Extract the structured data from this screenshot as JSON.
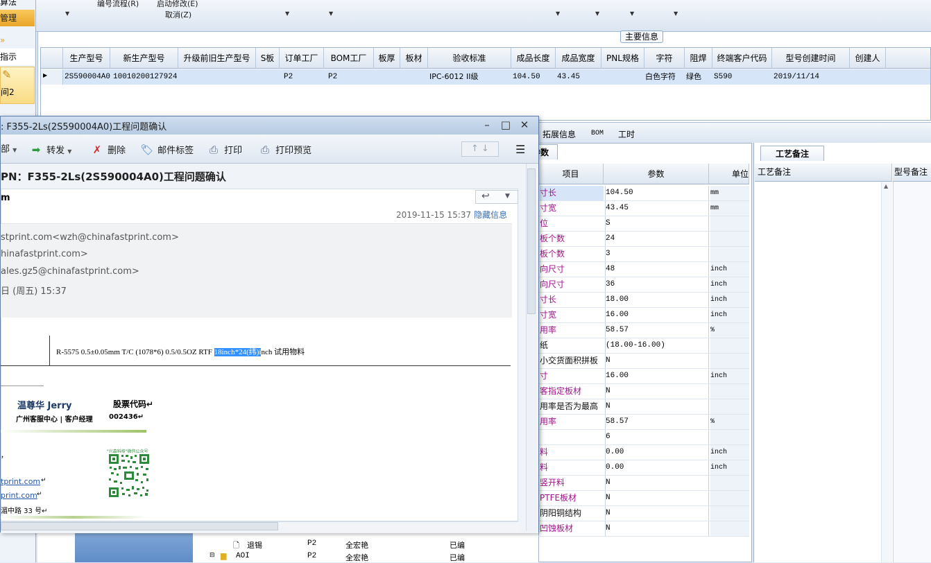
{
  "top_toolbar": {
    "left_cut": "算法",
    "item1": "编号流程(R)",
    "item2": "启动修改(E)",
    "item3": "取消(Z)"
  },
  "left_nav": {
    "mgmt": "管理",
    "guide": "指示",
    "sel_label": "间2"
  },
  "main_info_tab": "主要信息",
  "grid": {
    "headers": [
      "生产型号",
      "新生产型号",
      "升级前旧生产型号",
      "S板",
      "订单工厂",
      "BOM工厂",
      "板厚",
      "板材",
      "验收标准",
      "成品长度",
      "成品宽度",
      "PNL规格",
      "字符",
      "阻焊",
      "终端客户代码",
      "型号创建时间",
      "创建人"
    ],
    "row": [
      "2S590004A0",
      "10010200127924",
      "",
      "",
      "P2",
      "P2",
      "",
      "",
      "IPC-6012 II级",
      "104.50",
      "43.45",
      "",
      "白色字符",
      "绿色",
      "S590",
      "2019/11/14",
      ""
    ]
  },
  "tabs": {
    "ext_info": "拓展信息",
    "bom": "BOM",
    "work_hours": "工时"
  },
  "param_panel": {
    "tab_label": "参数",
    "headers": [
      "项目",
      "参数",
      "单位"
    ],
    "rows": [
      {
        "name": "寸长",
        "value": "104.50",
        "unit": "mm"
      },
      {
        "name": "寸宽",
        "value": "43.45",
        "unit": "mm"
      },
      {
        "name": "位",
        "value": "S",
        "unit": ""
      },
      {
        "name": "板个数",
        "value": "24",
        "unit": ""
      },
      {
        "name": "板个数",
        "value": "3",
        "unit": ""
      },
      {
        "name": "向尺寸",
        "value": "48",
        "unit": "inch"
      },
      {
        "name": "向尺寸",
        "value": "36",
        "unit": "inch"
      },
      {
        "name": "寸长",
        "value": "18.00",
        "unit": "inch"
      },
      {
        "name": "寸宽",
        "value": "16.00",
        "unit": "inch"
      },
      {
        "name": "用率",
        "value": "58.57",
        "unit": "%"
      },
      {
        "name": "纸",
        "value": "(18.00-16.00)",
        "unit": ""
      },
      {
        "name": "小交货面积拼板",
        "value": "N",
        "unit": ""
      },
      {
        "name": "寸",
        "value": "16.00",
        "unit": "inch"
      },
      {
        "name": "客指定板材",
        "value": "N",
        "unit": ""
      },
      {
        "name": "用率是否为最高",
        "value": "N",
        "unit": ""
      },
      {
        "name": "用率",
        "value": "58.57",
        "unit": "%"
      },
      {
        "name": "",
        "value": "6",
        "unit": ""
      },
      {
        "name": "料",
        "value": "0.00",
        "unit": "inch"
      },
      {
        "name": "料",
        "value": "0.00",
        "unit": "inch"
      },
      {
        "name": "竖开料",
        "value": "N",
        "unit": ""
      },
      {
        "name": "PTFE板材",
        "value": "N",
        "unit": ""
      },
      {
        "name": "阴阳铜结构",
        "value": "N",
        "unit": ""
      },
      {
        "name": "凹蚀板材",
        "value": "N",
        "unit": ""
      }
    ]
  },
  "remark_panel": {
    "tab_label": "工艺备注",
    "col1": "工艺备注",
    "col2": "型号备注"
  },
  "tree": {
    "item1": "退锡",
    "item1_factory": "P2",
    "item1_vendor": "全宏艳",
    "item1_status": "已编",
    "item2": "AOI",
    "item2_factory": "P2",
    "item2_vendor": "全宏艳",
    "item2_status": "已编"
  },
  "email": {
    "title": ": F355-2Ls(2S590004A0)工程问题确认",
    "toolbar": {
      "reply_all": "部",
      "forward": "转发",
      "delete": "删除",
      "tag": "邮件标签",
      "print": "打印",
      "print_preview": "打印预览"
    },
    "subject": "PN：F355-2Ls(2S590004A0)工程问题确认",
    "sender": "m",
    "date": "2019-11-15 15:37",
    "hide_info": "隐藏信息",
    "from_line": "stprint.com<wzh@chinafastprint.com>",
    "to_line": "hinafastprint.com>",
    "cc_line": "ales.gz5@chinafastprint.com>",
    "time_line": "日 (周五) 15:37",
    "body_text_pre": "R-5575 0.5±0.05mm T/C (1078*6) 0.5/0.5OZ RTF ",
    "body_text_hl": "18inch*24(纬)i",
    "body_text_post": "nch  试用物料",
    "signature": {
      "name": "温尊华 Jerry",
      "stock_label": "股票代码↵",
      "dept": "广州客服中心 | 客户经理",
      "stock_code": "002436↵",
      "qr_caption": "\"兴森科技\"微信公众号",
      "comma": "，",
      "link1": "tprint.com",
      "link2": "print.com",
      "addr": "湄中路 33 号↵"
    }
  }
}
